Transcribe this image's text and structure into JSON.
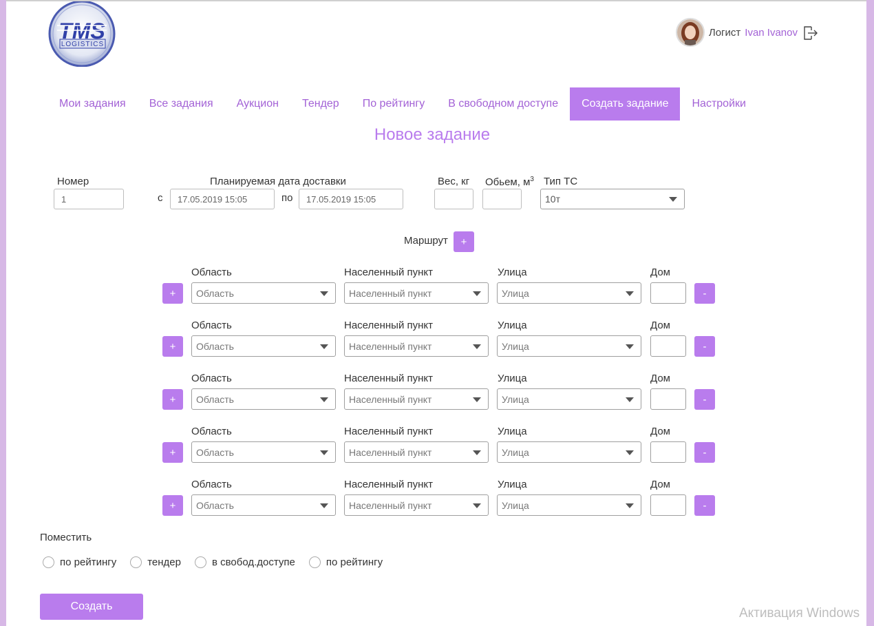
{
  "header": {
    "user_role": "Логист",
    "user_name": "Ivan Ivanov"
  },
  "nav": {
    "items": [
      {
        "label": "Мои задания"
      },
      {
        "label": "Все задания"
      },
      {
        "label": "Аукцион"
      },
      {
        "label": "Тендер"
      },
      {
        "label": "По рейтингу"
      },
      {
        "label": "В свободном доступе"
      },
      {
        "label": "Создать задание"
      },
      {
        "label": "Настройки"
      }
    ],
    "active": "Создать задание"
  },
  "page_title": "Новое задание",
  "form": {
    "number_label": "Номер",
    "number_value": "1",
    "delivery_label": "Планируемая дата доставки",
    "from_label": "с",
    "from_value": "17.05.2019 15:05",
    "to_label": "по",
    "to_value": "17.05.2019 15:05",
    "weight_label": "Вес, кг",
    "volume_label": "Обьем, м",
    "volume_sup": "3",
    "vehicle_label": "Тип ТС",
    "vehicle_value": "10т",
    "route_label": "Маршрут",
    "route_add": "+"
  },
  "route": {
    "region_label": "Область",
    "region_placeholder": "Область",
    "city_label": "Населенный пункт",
    "city_placeholder": "Населенный пункт",
    "street_label": "Улица",
    "street_placeholder": "Улица",
    "house_label": "Дом",
    "add": "+",
    "remove": "-",
    "rows": 5
  },
  "placement": {
    "label": "Поместить",
    "options": [
      "по рейтингу",
      "тендер",
      "в свобод.доступе",
      "по рейтингу"
    ]
  },
  "create_button": "Создать",
  "watermark": "Активация Windows",
  "colors": {
    "accent": "#b97ced",
    "link": "#a362d6",
    "side_background": "#d7b8e6"
  }
}
